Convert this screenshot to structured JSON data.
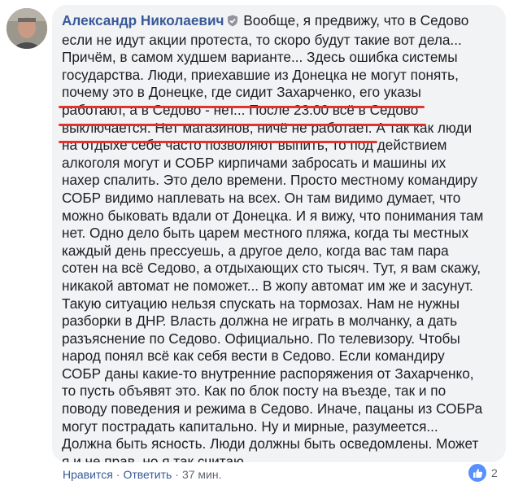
{
  "comment": {
    "author": "Александр Николаевич",
    "text_lines": [
      "Вообще, я предвижу, что в Седово",
      "если не идут акции протеста, то скоро будут такие вот дела...",
      "Причём, в самом худшем варианте... Здесь ошибка системы",
      "государства. Люди, приехавшие из Донецка не могут понять,",
      "почему это в Донецке, где сидит Захарченко, его указы",
      "работают, а в Седово - нет... После 23.00 всё в Седово",
      "выключается. Нет магазинов, ничё не работает. А так как люди",
      "на отдыхе себе часто позволяют выпить, то под действием",
      "алкоголя могут и СОБР кирпичами забросать и машины их",
      "нахер спалить. Это дело времени. Просто местному командиру",
      "СОБР видимо наплевать на всех. Он там видимо думает, что",
      "можно быковать вдали от Донецка. И я вижу, что понимания там",
      "нет. Одно дело быть царем местного пляжа, когда ты местных",
      "каждый день прессуешь, а другое дело, когда вас там пара",
      "сотен на всё Седово, а отдыхающих сто тысяч. Тут, я вам скажу,",
      "никакой автомат не поможет... В жопу автомат им же и засунут.",
      "Такую ситуацию нельзя спускать на тормозах. Нам не нужны",
      "разборки в ДНР. Власть должна не играть в молчанку, а дать",
      "разъяснение по Седово. Официально. По телевизору. Чтобы",
      "народ понял всё как себя вести в Седово. Если командиру",
      "СОБР даны какие-то внутренние распоряжения от Захарченко,",
      "то пусть объявят это. Как по блок посту на въезде, так и по",
      "поводу поведения и режима в Седово. Иначе, пацаны из СОБРа",
      "могут пострадать капитально. Ну и мирные, разумеется...",
      "Должна быть ясность. Люди должны быть осведомлены. Может",
      "я и не прав, но я так считаю."
    ]
  },
  "footer": {
    "like_label": "Нравится",
    "separator": "·",
    "reply_label": "Ответить",
    "time": "37 мин."
  },
  "reactions": {
    "count": "2",
    "icon": "thumbs-up-icon",
    "color": "#5890ff"
  },
  "colors": {
    "author": "#385898",
    "bubble": "#f2f3f5",
    "highlight_underline": "#e4322e"
  }
}
